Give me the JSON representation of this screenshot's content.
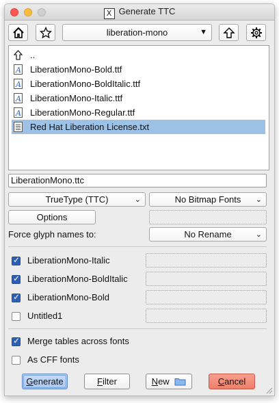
{
  "window": {
    "title": "Generate TTC"
  },
  "toolbar": {
    "directory": "liberation-mono",
    "home_icon": "home-icon",
    "bookmark_icon": "star-icon",
    "parent_icon": "up-arrow-icon",
    "settings_icon": "gear-icon"
  },
  "files": [
    {
      "name": "..",
      "icon": "up-arrow-icon",
      "selected": false
    },
    {
      "name": "LiberationMono-Bold.ttf",
      "icon": "font-file-icon",
      "selected": false
    },
    {
      "name": "LiberationMono-BoldItalic.ttf",
      "icon": "font-file-icon",
      "selected": false
    },
    {
      "name": "LiberationMono-Italic.ttf",
      "icon": "font-file-icon",
      "selected": false
    },
    {
      "name": "LiberationMono-Regular.ttf",
      "icon": "font-file-icon",
      "selected": false
    },
    {
      "name": "Red Hat Liberation License.txt",
      "icon": "text-file-icon",
      "selected": true
    }
  ],
  "filename": "LiberationMono.ttc",
  "format": {
    "font_type": "TrueType (TTC)",
    "bitmap": "No Bitmap Fonts"
  },
  "options_label": "Options",
  "force_glyph": {
    "label": "Force glyph names to:",
    "value": "No Rename"
  },
  "fonts": [
    {
      "name": "LiberationMono-Italic",
      "checked": true
    },
    {
      "name": "LiberationMono-BoldItalic",
      "checked": true
    },
    {
      "name": "LiberationMono-Bold",
      "checked": true
    },
    {
      "name": "Untitled1",
      "checked": false
    }
  ],
  "merge": {
    "label": "Merge tables across fonts",
    "checked": true
  },
  "cff": {
    "label": "As CFF fonts",
    "checked": false
  },
  "buttons": {
    "generate": {
      "mnemonic": "G",
      "rest": "enerate"
    },
    "filter": {
      "mnemonic": "F",
      "rest": "ilter"
    },
    "new": {
      "mnemonic": "N",
      "rest": "ew"
    },
    "cancel": {
      "mnemonic": "C",
      "rest": "ancel"
    }
  },
  "colors": {
    "selection": "#9ec1e6",
    "accent": "#2e5fb5",
    "cancel": "#ee7e6a",
    "generate": "#a9c7ef"
  }
}
